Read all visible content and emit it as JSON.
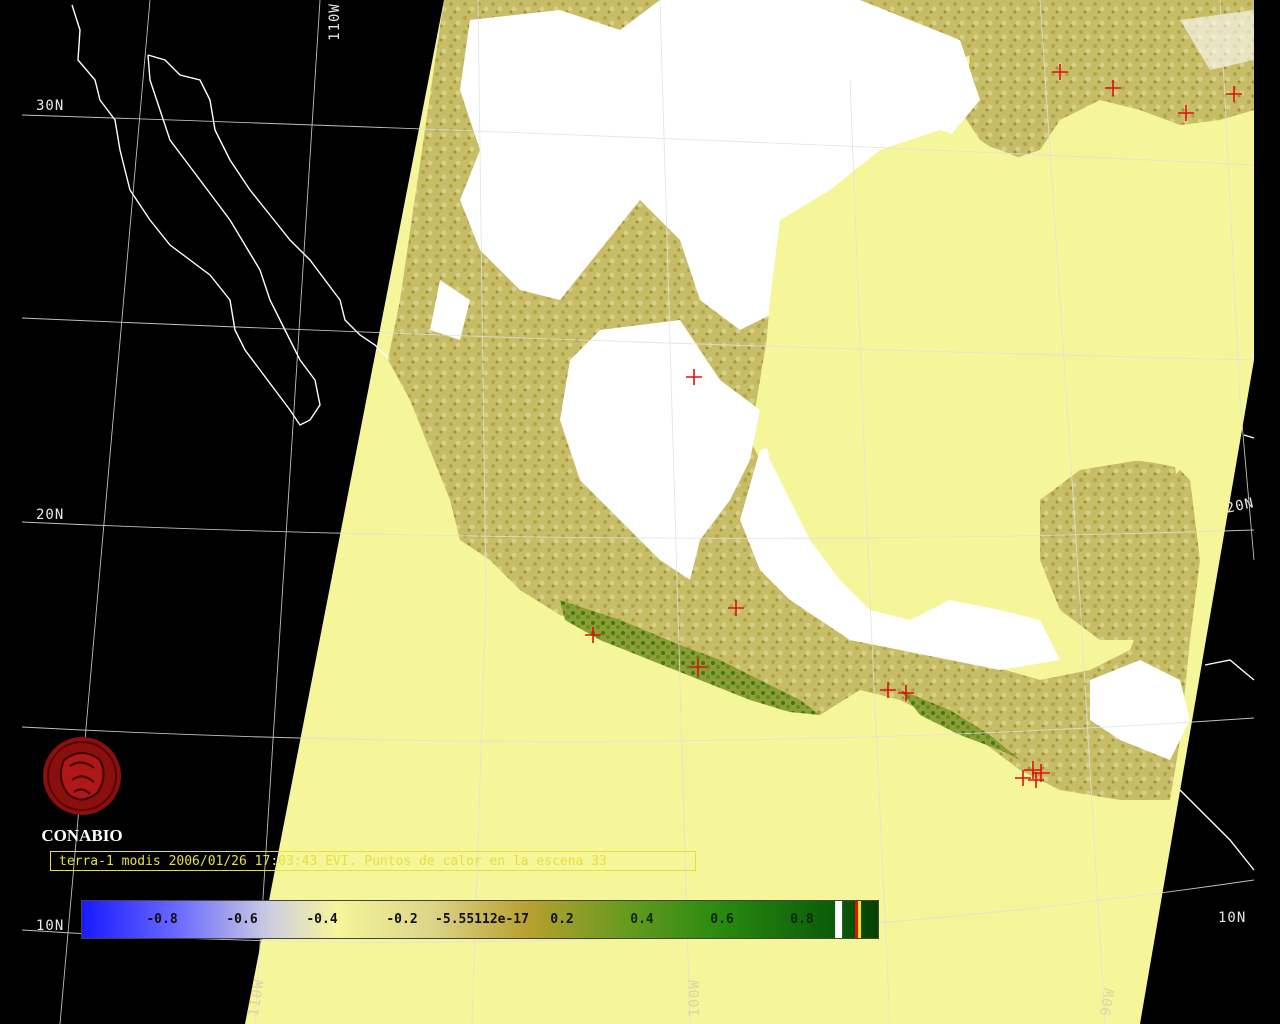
{
  "caption": {
    "text": "terra-1 modis 2006/01/26 17:03:43 EVI. Puntos de calor en la escena 33"
  },
  "logo": {
    "text": "CONABIO"
  },
  "grid_labels": {
    "lat_30n_left": "30N",
    "lat_20n_left": "20N",
    "lat_10n_left": "10N",
    "lat_10n_right": "10N",
    "lat_20n_right": "20N",
    "lon_110w_top": "110W",
    "lon_100w_bottom": "100W",
    "lon_90w_bottom": "90W",
    "lon_120w_bottom": "110W"
  },
  "legend": {
    "ticks": [
      "-0.8",
      "-0.6",
      "-0.4",
      "-0.2",
      "-5.55112e-17",
      "0.2",
      "0.4",
      "0.6",
      "0.8"
    ],
    "range": [
      -1.0,
      1.0
    ],
    "colors": {
      "low": "#1a1aff",
      "mid_low": "#d8d8e8",
      "zero_yellow": "#f5f59a",
      "mid": "#b8a030",
      "high": "#2a8a10",
      "top": "#064006"
    }
  },
  "colors": {
    "ocean_swath": "#f5f59a",
    "background": "#000000",
    "cloud": "#ffffff",
    "coast": "#ffffff",
    "grid": "#e0e0e0",
    "hotspot": "#e01010",
    "caption": "#e7e03a"
  },
  "hotspots_count_label": "33"
}
